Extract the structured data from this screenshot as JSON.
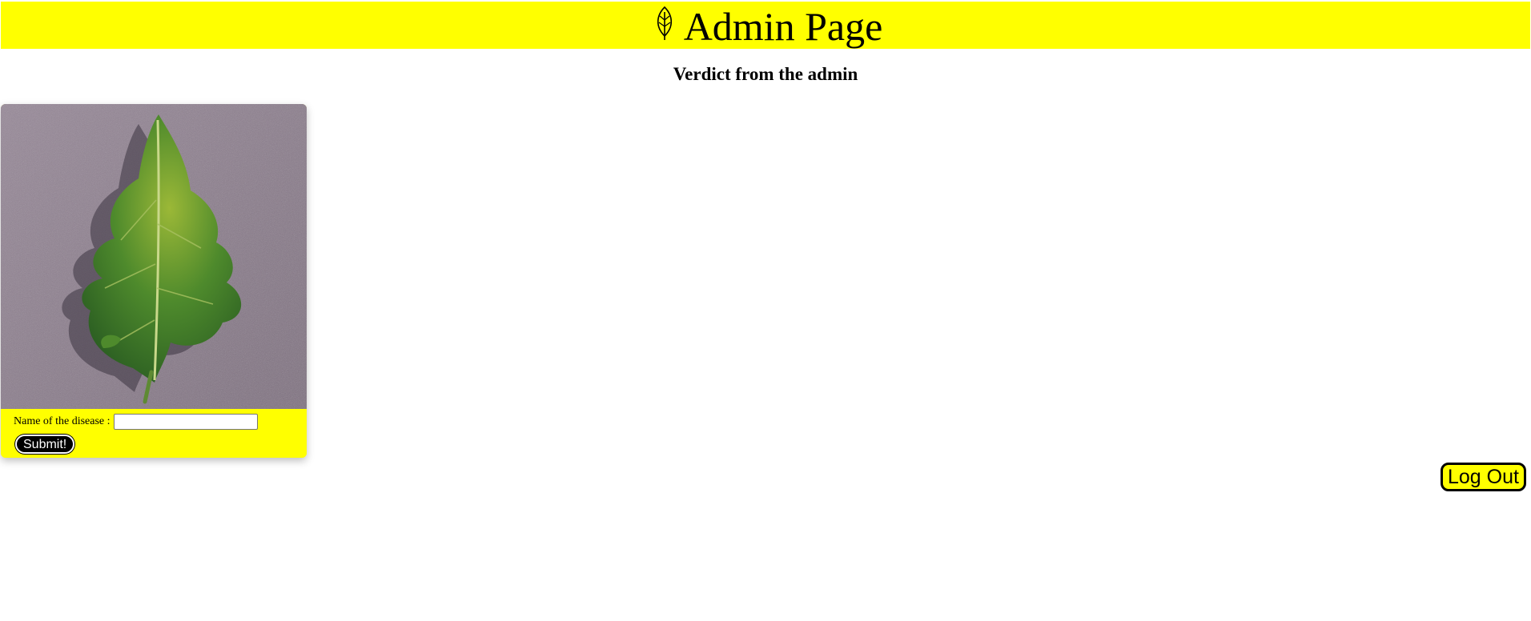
{
  "header": {
    "title": "Admin Page",
    "icon": "leaf-icon",
    "background": "#ffff00"
  },
  "main": {
    "subtitle": "Verdict from the admin"
  },
  "card": {
    "image": "leaf-photo",
    "field_label": "Name of the disease :",
    "field_value": "",
    "field_placeholder": "",
    "submit_label": "Submit!"
  },
  "footer": {
    "logout_label": "Log Out"
  },
  "colors": {
    "accent": "#ffff00",
    "text": "#000000"
  }
}
